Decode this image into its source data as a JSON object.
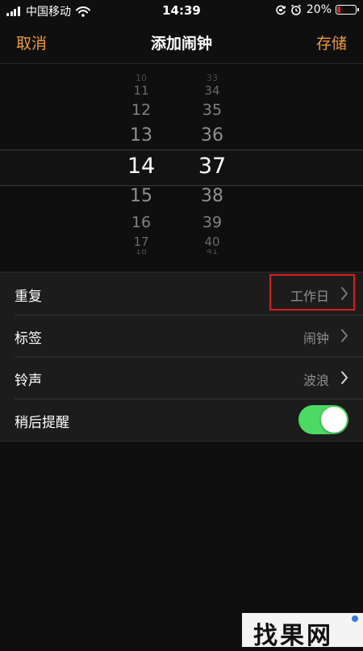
{
  "status_bar": {
    "carrier": "中国移动",
    "time": "14:39",
    "battery_percent": "20%",
    "battery_level": 0.2,
    "icons": [
      "signal-icon",
      "wifi-icon",
      "rotation-lock-icon",
      "alarm-icon",
      "battery-icon"
    ]
  },
  "nav": {
    "cancel_label": "取消",
    "title": "添加闹钟",
    "save_label": "存储"
  },
  "picker": {
    "hours": [
      "10",
      "11",
      "12",
      "13",
      "14",
      "15",
      "16",
      "17",
      "18"
    ],
    "minutes": [
      "33",
      "34",
      "35",
      "36",
      "37",
      "38",
      "39",
      "40",
      "41"
    ],
    "selected_hour": "14",
    "selected_minute": "37"
  },
  "settings": {
    "repeat": {
      "label": "重复",
      "value": "工作日"
    },
    "tag": {
      "label": "标签",
      "value": "闹钟"
    },
    "sound": {
      "label": "铃声",
      "value": "波浪"
    },
    "snooze": {
      "label": "稍后提醒",
      "enabled": true
    }
  },
  "colors": {
    "accent": "#f09a37",
    "toggle_on": "#4cd964",
    "highlight": "#e11b1b",
    "battery_low": "#e02020"
  },
  "watermark": {
    "text": "找果网"
  }
}
